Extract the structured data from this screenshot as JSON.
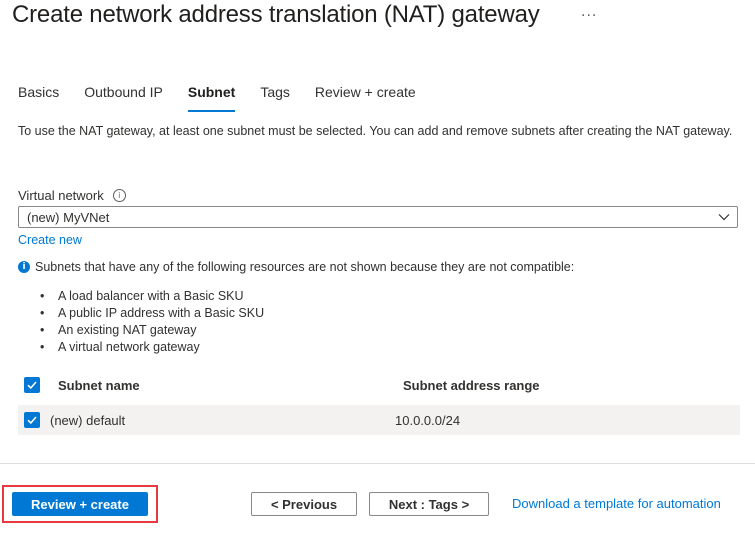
{
  "page": {
    "title": "Create network address translation (NAT) gateway",
    "more_icon": "ellipsis-icon",
    "more_label": "..."
  },
  "tabs": [
    {
      "label": "Basics",
      "active": false
    },
    {
      "label": "Outbound IP",
      "active": false
    },
    {
      "label": "Subnet",
      "active": true
    },
    {
      "label": "Tags",
      "active": false
    },
    {
      "label": "Review + create",
      "active": false
    }
  ],
  "subnet": {
    "description": "To use the NAT gateway, at least one subnet must be selected. You can add and remove subnets after creating the NAT gateway.",
    "vnet_label": "Virtual network",
    "vnet_info_icon": "info-outline-icon",
    "vnet_value": "(new) MyVNet",
    "create_new": "Create new",
    "compat_info_icon": "info-filled-icon",
    "compat_note": "Subnets that have any of the following resources are not shown because they are not compatible:",
    "compat_items": [
      "A load balancer with a Basic SKU",
      "A public IP address with a Basic SKU",
      "An existing NAT gateway",
      "A virtual network gateway"
    ]
  },
  "table": {
    "headers": {
      "name": "Subnet name",
      "range": "Subnet address range"
    },
    "select_all_checked": true,
    "rows": [
      {
        "name": "(new) default",
        "range": "10.0.0.0/24",
        "checked": true
      }
    ]
  },
  "footer": {
    "review_create": "Review + create",
    "previous": "< Previous",
    "next": "Next : Tags >",
    "download": "Download a template for automation"
  },
  "colors": {
    "accent": "#0078d4",
    "highlight": "#e8393f"
  }
}
